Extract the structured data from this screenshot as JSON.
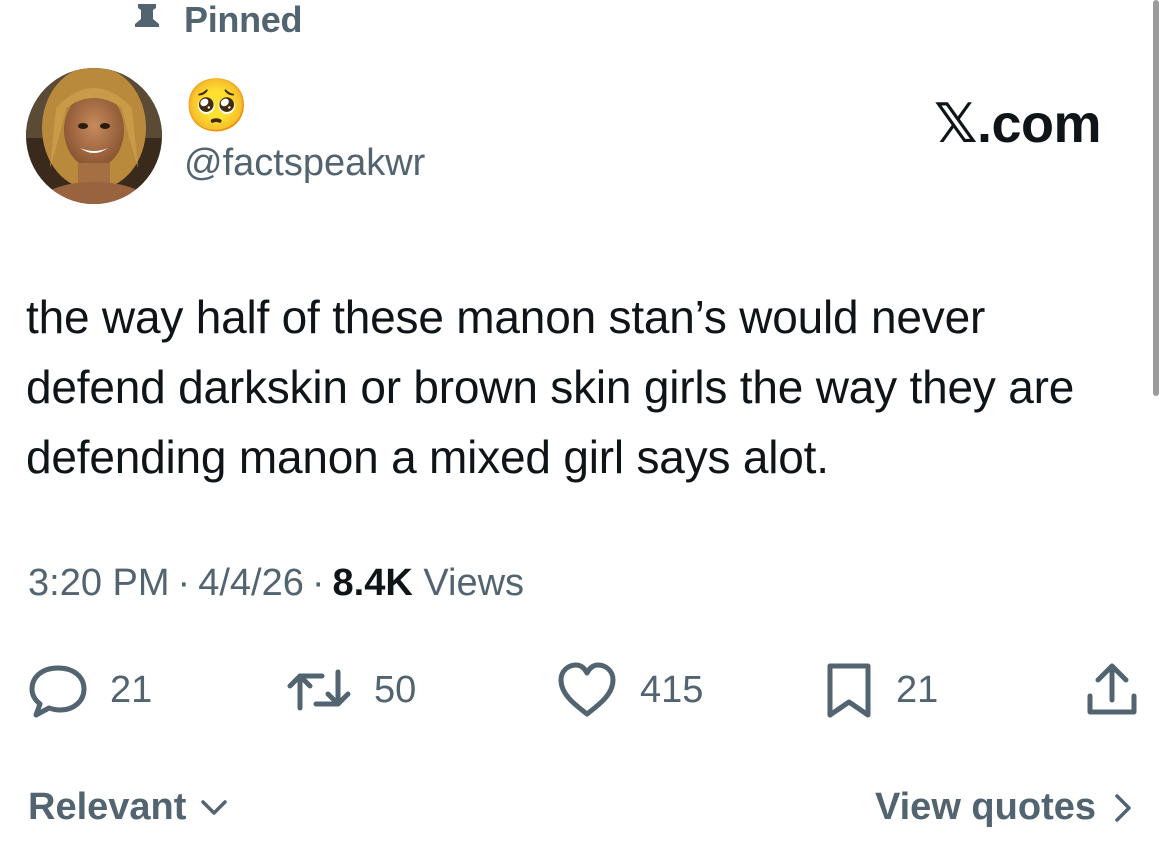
{
  "header": {
    "pinned_label": "Pinned"
  },
  "author": {
    "display_name": "🥺",
    "handle": "@factspeakwr",
    "avatar_icon": "profile-photo"
  },
  "brand": {
    "text": "𝕏.com"
  },
  "tweet": {
    "text": "the way half of these manon stan’s would never defend darkskin or brown skin girls the way they are defending manon a mixed girl says alot."
  },
  "meta": {
    "time": "3:20 PM",
    "separator": "·",
    "date": "4/4/26",
    "views_count": "8.4K",
    "views_label": "Views"
  },
  "actions": {
    "replies": "21",
    "reposts": "50",
    "likes": "415",
    "bookmarks": "21"
  },
  "footer": {
    "relevant_label": "Relevant",
    "view_quotes_label": "View quotes"
  },
  "colors": {
    "text_primary": "#0f1419",
    "text_secondary": "#536471",
    "background": "#ffffff"
  }
}
